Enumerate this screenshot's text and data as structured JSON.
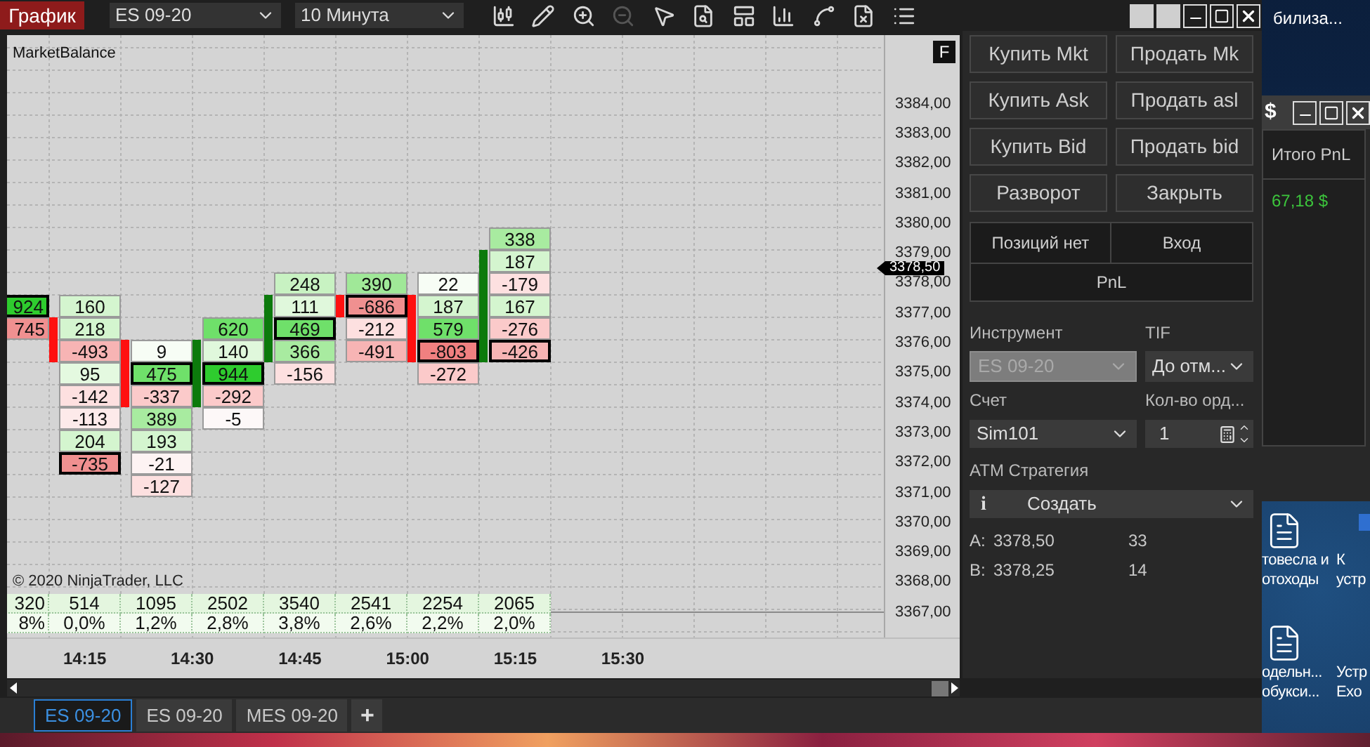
{
  "toolbar": {
    "title_button": "График",
    "instrument": "ES 09-20",
    "interval": "10 Минута",
    "tools": [
      {
        "kind": "candles",
        "disabled": false
      },
      {
        "kind": "pencil",
        "disabled": false
      },
      {
        "kind": "zoom_in",
        "disabled": false
      },
      {
        "kind": "zoom_out",
        "disabled": true
      },
      {
        "kind": "cursor",
        "disabled": false
      },
      {
        "kind": "doc_search",
        "disabled": false
      },
      {
        "kind": "layout",
        "disabled": false
      },
      {
        "kind": "bars",
        "disabled": false
      },
      {
        "kind": "line",
        "disabled": false
      },
      {
        "kind": "doc_x",
        "disabled": false
      },
      {
        "kind": "list",
        "disabled": false
      }
    ]
  },
  "chart": {
    "indicator": "MarketBalance",
    "f_button": "F",
    "price_labels": [
      "3384,00",
      "3383,00",
      "3382,00",
      "3381,00",
      "3380,00",
      "3379,00",
      "3378,00",
      "3377,00",
      "3376,00",
      "3375,00",
      "3374,00",
      "3373,00",
      "3372,00",
      "3371,00",
      "3370,00",
      "3369,00",
      "3368,00",
      "3367,00"
    ],
    "current_price": "3378,50",
    "bars": [
      {
        "cells": [
          {
            "kind": "gap"
          },
          {
            "kind": "gap"
          },
          {
            "kind": "gap"
          },
          {
            "kind": "value",
            "value": "924",
            "color": "#2ecc2e",
            "max": true,
            "body": false
          },
          {
            "kind": "value",
            "value": "745",
            "color": "#f09090",
            "max": false,
            "body": false
          }
        ]
      },
      {
        "rising": false,
        "cells": [
          {
            "kind": "gap"
          },
          {
            "kind": "gap"
          },
          {
            "kind": "gap"
          },
          {
            "kind": "value",
            "value": "160",
            "color": "#d4f5cf",
            "max": false,
            "body": false
          },
          {
            "kind": "value",
            "value": "218",
            "color": "#d4f5cf",
            "max": false,
            "body": true
          },
          {
            "kind": "value",
            "value": "-493",
            "color": "#f7b4b4",
            "max": false,
            "body": true
          },
          {
            "kind": "value",
            "value": "95",
            "color": "#e4f9e0",
            "max": false,
            "body": false
          },
          {
            "kind": "value",
            "value": "-142",
            "color": "#fde0e0",
            "max": false,
            "body": false
          },
          {
            "kind": "value",
            "value": "-113",
            "color": "#fdeaea",
            "max": false,
            "body": false
          },
          {
            "kind": "value",
            "value": "204",
            "color": "#d4f5cf",
            "max": false,
            "body": false
          },
          {
            "kind": "value",
            "value": "-735",
            "color": "#f09090",
            "max": true,
            "body": false
          }
        ]
      },
      {
        "rising": false,
        "cells": [
          {
            "kind": "gap"
          },
          {
            "kind": "gap"
          },
          {
            "kind": "gap"
          },
          {
            "kind": "gap"
          },
          {
            "kind": "gap"
          },
          {
            "kind": "value",
            "value": "9",
            "color": "#f7fdf5",
            "max": false,
            "body": true
          },
          {
            "kind": "value",
            "value": "475",
            "color": "#6fe06a",
            "max": true,
            "body": true
          },
          {
            "kind": "value",
            "value": "-337",
            "color": "#fbcaca",
            "max": false,
            "body": true
          },
          {
            "kind": "value",
            "value": "389",
            "color": "#a8eba0",
            "max": false,
            "body": false
          },
          {
            "kind": "value",
            "value": "193",
            "color": "#d4f5cf",
            "max": false,
            "body": false
          },
          {
            "kind": "value",
            "value": "-21",
            "color": "#fdf3f3",
            "max": false,
            "body": false
          },
          {
            "kind": "value",
            "value": "-127",
            "color": "#fde0e0",
            "max": false,
            "body": false
          }
        ]
      },
      {
        "rising": true,
        "cells": [
          {
            "kind": "gap"
          },
          {
            "kind": "gap"
          },
          {
            "kind": "gap"
          },
          {
            "kind": "gap"
          },
          {
            "kind": "value",
            "value": "620",
            "color": "#6fe06a",
            "max": false,
            "body": false
          },
          {
            "kind": "value",
            "value": "140",
            "color": "#e0f8dc",
            "max": false,
            "body": true
          },
          {
            "kind": "value",
            "value": "944",
            "color": "#2ecc2e",
            "max": true,
            "body": true
          },
          {
            "kind": "value",
            "value": "-292",
            "color": "#fbcaca",
            "max": false,
            "body": true
          },
          {
            "kind": "value",
            "value": "-5",
            "color": "#fdf8f8",
            "max": false,
            "body": false
          }
        ]
      },
      {
        "rising": true,
        "cells": [
          {
            "kind": "gap"
          },
          {
            "kind": "gap"
          },
          {
            "kind": "value",
            "value": "248",
            "color": "#c8f2c2",
            "max": false,
            "body": false
          },
          {
            "kind": "value",
            "value": "111",
            "color": "#e0f8dc",
            "max": false,
            "body": true
          },
          {
            "kind": "value",
            "value": "469",
            "color": "#6fe06a",
            "max": true,
            "body": true
          },
          {
            "kind": "value",
            "value": "366",
            "color": "#a8eba0",
            "max": false,
            "body": true
          },
          {
            "kind": "value",
            "value": "-156",
            "color": "#fde0e0",
            "max": false,
            "body": false
          }
        ]
      },
      {
        "rising": false,
        "cells": [
          {
            "kind": "gap"
          },
          {
            "kind": "gap"
          },
          {
            "kind": "value",
            "value": "390",
            "color": "#a0e898",
            "max": false,
            "body": false
          },
          {
            "kind": "value",
            "value": "-686",
            "color": "#f09090",
            "max": true,
            "body": true
          },
          {
            "kind": "value",
            "value": "-212",
            "color": "#fde0e0",
            "max": false,
            "body": false
          },
          {
            "kind": "value",
            "value": "-491",
            "color": "#f7b4b4",
            "max": false,
            "body": false
          }
        ]
      },
      {
        "rising": false,
        "cells": [
          {
            "kind": "gap"
          },
          {
            "kind": "gap"
          },
          {
            "kind": "value",
            "value": "22",
            "color": "#f7fdf5",
            "max": false,
            "body": false
          },
          {
            "kind": "value",
            "value": "187",
            "color": "#d4f5cf",
            "max": false,
            "body": true
          },
          {
            "kind": "value",
            "value": "579",
            "color": "#6fe06a",
            "max": false,
            "body": true
          },
          {
            "kind": "value",
            "value": "-803",
            "color": "#f08080",
            "max": true,
            "body": true
          },
          {
            "kind": "value",
            "value": "-272",
            "color": "#fbcaca",
            "max": false,
            "body": false
          }
        ]
      },
      {
        "rising": true,
        "cells": [
          {
            "kind": "value",
            "value": "338",
            "color": "#a8eba0",
            "max": false,
            "body": false
          },
          {
            "kind": "value",
            "value": "187",
            "color": "#d4f5cf",
            "max": false,
            "body": true
          },
          {
            "kind": "value",
            "value": "-179",
            "color": "#fde0e0",
            "max": false,
            "body": true
          },
          {
            "kind": "value",
            "value": "167",
            "color": "#d4f5cf",
            "max": false,
            "body": true
          },
          {
            "kind": "value",
            "value": "-276",
            "color": "#fbcaca",
            "max": false,
            "body": true
          },
          {
            "kind": "value",
            "value": "-426",
            "color": "#f7b4b4",
            "max": true,
            "body": true
          }
        ]
      }
    ],
    "stats": [
      {
        "volume": "320",
        "percent": "8%"
      },
      {
        "volume": "514",
        "percent": "0,0%"
      },
      {
        "volume": "1095",
        "percent": "1,2%"
      },
      {
        "volume": "2502",
        "percent": "2,8%"
      },
      {
        "volume": "3540",
        "percent": "3,8%"
      },
      {
        "volume": "2541",
        "percent": "2,6%"
      },
      {
        "volume": "2254",
        "percent": "2,2%"
      },
      {
        "volume": "2065",
        "percent": "2,0%"
      }
    ],
    "copyright": "© 2020 NinjaTrader, LLC",
    "time_labels": [
      "14:15",
      "14:30",
      "14:45",
      "15:00",
      "15:15",
      "15:30"
    ]
  },
  "tabs": [
    {
      "label": "ES 09-20",
      "selected": true
    },
    {
      "label": "ES 09-20",
      "selected": false
    },
    {
      "label": "MES 09-20",
      "selected": false
    }
  ],
  "add_tab": "+",
  "order_panel": {
    "buttons": [
      "Купить Mkt",
      "Продать Mk",
      "Купить Ask",
      "Продать asl",
      "Купить Bid",
      "Продать bid",
      "Разворот",
      "Закрыть"
    ],
    "position": "Позиций нет",
    "entry": "Вход",
    "pnl": "PnL",
    "instrument_label": "Инструмент",
    "instrument": {
      "value": "ES 09-20",
      "disabled": true
    },
    "tif_label": "TIF",
    "tif": "До отм...",
    "account_label": "Счет",
    "account": "Sim101",
    "qty_label": "Кол-во орд...",
    "qty": "1",
    "atm_label": "ATM Стратегия",
    "atm_info": "i",
    "atm": "Создать",
    "quotes": [
      {
        "label": "A:",
        "price": "3378,50",
        "size": "33"
      },
      {
        "label": "B:",
        "price": "3378,25",
        "size": "14"
      }
    ]
  },
  "pnl_window": {
    "title": "$",
    "header": "Итого PnL",
    "value": "67,18 $"
  },
  "desktop": {
    "top_label": "билиза...",
    "icons": [
      {
        "kind": "document",
        "lines": [
          "товесла и",
          "отоходы"
        ]
      },
      {
        "kind": "app",
        "lines": [
          "К",
          "устр"
        ]
      },
      {
        "kind": "document",
        "lines": [
          "одельн...",
          "обукси..."
        ]
      },
      {
        "kind": "none",
        "lines": [
          "Устр",
          "Exo"
        ]
      }
    ]
  }
}
